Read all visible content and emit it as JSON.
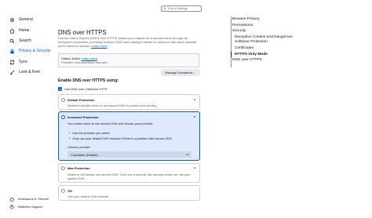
{
  "nav": {
    "items": [
      {
        "label": "General",
        "icon": "gear-icon"
      },
      {
        "label": "Home",
        "icon": "home-icon"
      },
      {
        "label": "Search",
        "icon": "search-icon"
      },
      {
        "label": "Privacy & Security",
        "icon": "lock-icon"
      },
      {
        "label": "Sync",
        "icon": "sync-icon"
      },
      {
        "label": "Look & Feel",
        "icon": "paintbrush-icon"
      }
    ],
    "footer": [
      {
        "label": "Extensions & Themes",
        "icon": "puzzle-icon"
      },
      {
        "label": "Waterfox Support",
        "icon": "help-icon"
      }
    ]
  },
  "search": {
    "placeholder": "Find in Settings"
  },
  "main": {
    "title": "DNS over HTTPS",
    "description": "Domain Name System (DNS) over HTTPS sends your request for a domain name through an encrypted connection, providing a secure DNS and making it harder for others to see which website you're about to access.",
    "learn_more": "Learn more",
    "status_label": "Status: Active",
    "status_learn_more": "Learn more",
    "provider_label": "Provider: doh.cloudflare-dns.com",
    "manage_button": "Manage Exceptions…",
    "enable_heading": "Enable DNS over HTTPS using:",
    "obvious_checkbox": "Use DNS over Oblivious HTTP",
    "options": [
      {
        "title": "Default Protection",
        "desc": "Waterfox decides when to use secure DNS to protect your privacy."
      },
      {
        "title": "Increased Protection",
        "desc": "You control when to use secure DNS and choose your provider.",
        "bullets": [
          "Use the provider you select",
          "Only use your default DNS resolver if there is a problem with secure DNS"
        ],
        "provider_label": "Choose provider:",
        "provider_value": "Cloudflare (Default)"
      },
      {
        "title": "Max Protection",
        "desc": "Waterfox will always use secure DNS. You'll see a security risk warning before we use your system DNS."
      },
      {
        "title": "Off",
        "desc": "Use your default DNS resolver"
      }
    ]
  },
  "toc": {
    "items": [
      "Browser Privacy",
      "Permissions",
      "Security",
      "Deceptive Content and Dangerous",
      "Software Protection",
      "Certificates",
      "HTTPS-Only Mode",
      "DNS over HTTPS"
    ]
  },
  "colors": {
    "accent": "#0061e0",
    "selected_card_bg": "#deeafc",
    "text": "#15141a",
    "muted_text": "#5b5b66"
  }
}
